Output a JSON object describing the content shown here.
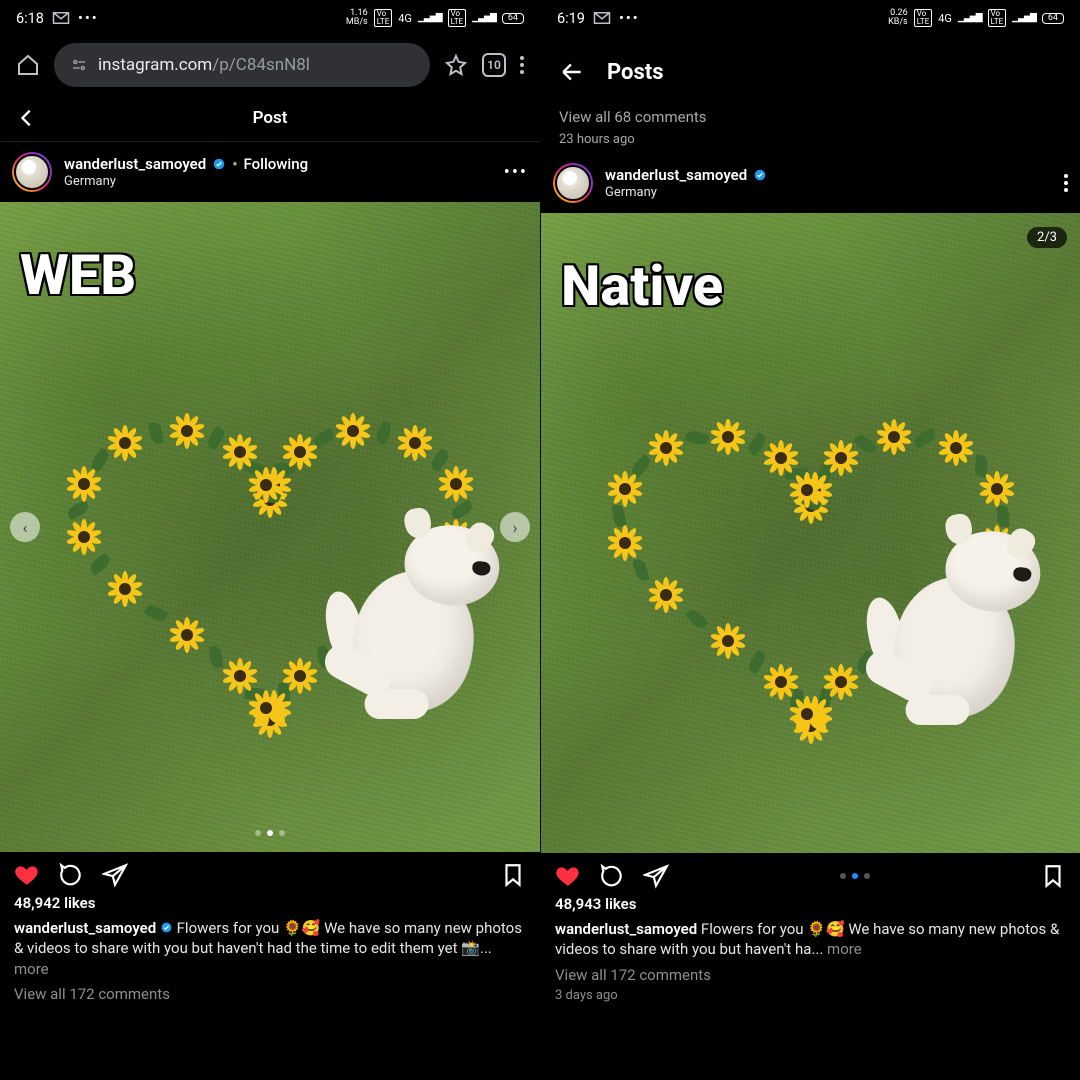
{
  "left": {
    "status": {
      "time": "6:18",
      "speed": "1.16",
      "speed_unit": "MB/s",
      "net": "4G",
      "battery": "64"
    },
    "url_prefix": "instagram.com",
    "url_suffix": "/p/C84snN8l",
    "tabs": "10",
    "ig_title": "Post",
    "username": "wanderlust_samoyed",
    "following": "Following",
    "location": "Germany",
    "overlay": "WEB",
    "likes": "48,942 likes",
    "caption_user": "wanderlust_samoyed",
    "caption_text_1": " Flowers for you 🌻🥰 We have so many new photos & videos to share with you but haven't had the time to edit them yet 📸...",
    "caption_more": " more",
    "view_comments": "View all 172 comments"
  },
  "right": {
    "status": {
      "time": "6:19",
      "speed": "0.26",
      "speed_unit": "KB/s",
      "net": "4G",
      "battery": "64"
    },
    "top_title": "Posts",
    "prev_comments": "View all 68 comments",
    "prev_time": "23 hours ago",
    "username": "wanderlust_samoyed",
    "location": "Germany",
    "overlay": "Native",
    "count_badge": "2/3",
    "likes": "48,943 likes",
    "caption_user": "wanderlust_samoyed",
    "caption_text_1": " Flowers for you 🌻🥰 We have so many new photos & videos to share with you but haven't ha...",
    "caption_more": " more",
    "view_comments": "View all 172 comments",
    "time_ago": "3 days ago"
  }
}
